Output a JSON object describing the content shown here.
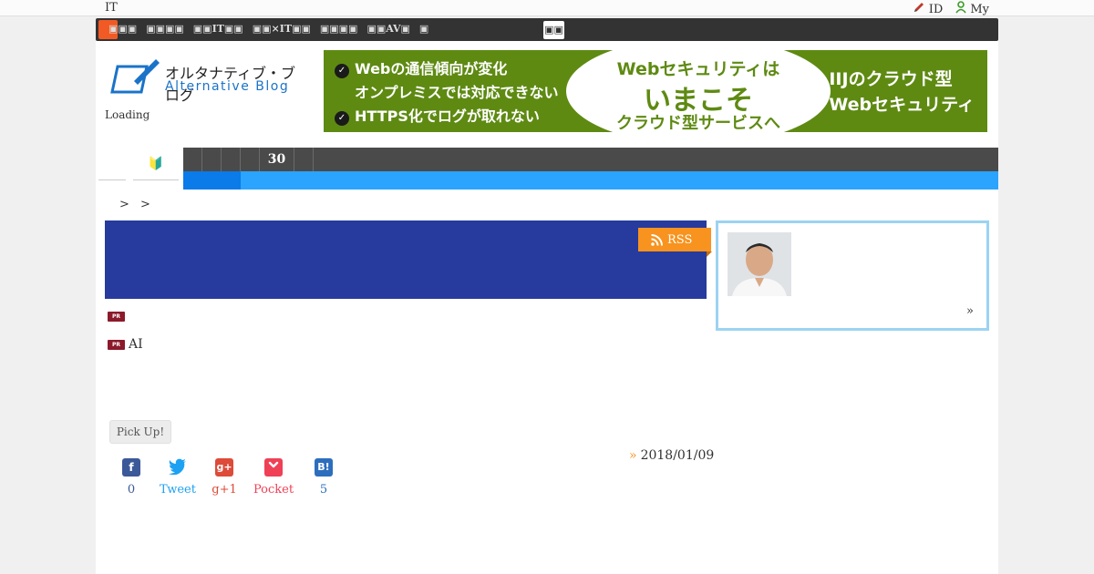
{
  "topbar": {
    "site_label": "IT",
    "id_label": "ID",
    "my_label": "My"
  },
  "navstrip": {
    "links": [
      "",
      "",
      "IT",
      "×IT",
      "",
      "AV",
      ""
    ]
  },
  "logo": {
    "jp": "オルタナティブ・ブログ",
    "en": "Alternative Blog"
  },
  "loading_text": "Loading",
  "banner": {
    "left_line1": "Webの通信傾向が変化",
    "left_line2": "オンプレミスでは対応できない",
    "left_line3": "HTTPS化でログが取れない",
    "mid_line1": "Webセキュリティは",
    "mid_line2": "いまこそ",
    "mid_line3": "クラウド型サービスへ",
    "right_line1": "IIJのクラウド型",
    "right_line2": "Webセキュリティ"
  },
  "category": {
    "beginner_icon": "🔰",
    "dark_segments": [
      "",
      "",
      "",
      "",
      "30",
      ""
    ]
  },
  "breadcrumb": "> >",
  "rss_label": "RSS",
  "profile": {
    "more": "»"
  },
  "pr_items": [
    {
      "badge": "PR",
      "text": ""
    },
    {
      "badge": "PR",
      "text": "AI"
    }
  ],
  "pickup_label": "Pick Up!",
  "post_date": "2018/01/09",
  "post_date_arrow": "»",
  "share": [
    {
      "name": "facebook",
      "icon": "f",
      "label": "0",
      "color": "#3b5998"
    },
    {
      "name": "twitter",
      "icon": "t",
      "label": "Tweet",
      "color": "#1da1f2"
    },
    {
      "name": "googleplus",
      "icon": "g+",
      "label": "g+1",
      "color": "#dd4b39"
    },
    {
      "name": "pocket",
      "icon": "p",
      "label": "Pocket",
      "color": "#ef4056"
    },
    {
      "name": "hatena",
      "icon": "B!",
      "label": "5",
      "color": "#2c6ebd"
    }
  ]
}
